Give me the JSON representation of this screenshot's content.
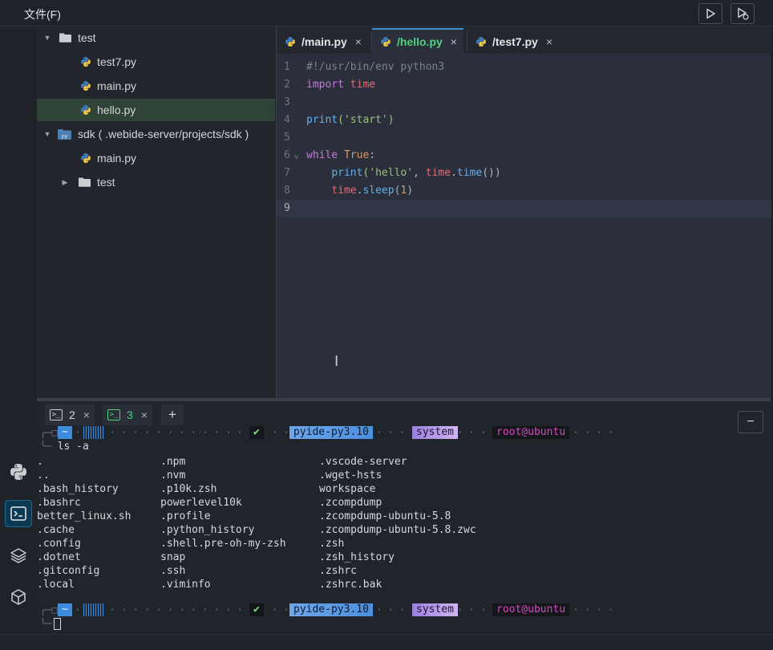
{
  "menu": {
    "file": "文件(F)"
  },
  "toolbar": {
    "run_icon": "play-icon",
    "debug_icon": "debug-run-icon"
  },
  "activity_bar": {
    "items": [
      "python-icon",
      "terminal-icon",
      "layers-icon",
      "package-icon"
    ]
  },
  "explorer": {
    "items": [
      {
        "label": "test"
      },
      {
        "label": "test7.py"
      },
      {
        "label": "main.py"
      },
      {
        "label": "hello.py"
      },
      {
        "label": "sdk ( .webide-server/projects/sdk )"
      },
      {
        "label": "main.py"
      },
      {
        "label": "test"
      }
    ]
  },
  "editor": {
    "tabs": [
      {
        "label": "/main.py",
        "close": "×"
      },
      {
        "label": "/hello.py",
        "close": "×"
      },
      {
        "label": "/test7.py",
        "close": "×"
      }
    ],
    "line_numbers": [
      "1",
      "2",
      "3",
      "4",
      "5",
      "6",
      "7",
      "8",
      "9"
    ],
    "code": {
      "l1": "#!/usr/bin/env python3",
      "l2_kw": "import",
      "l2_mod": "time",
      "l4_fn": "print",
      "l4_str": "('start')",
      "l6_kw": "while",
      "l6_const": "True",
      "l6_colon": ":",
      "l7_fn": "print",
      "l7_str": "('hello'",
      "l7_sep": ", ",
      "l7_mod": "time",
      "l7_dot": ".",
      "l7_fn2": "time",
      "l7_end": "())",
      "l8_mod": "time",
      "l8_dot": ".",
      "l8_fn": "sleep",
      "l8_open": "(",
      "l8_num": "1",
      "l8_close": ")"
    }
  },
  "terminal": {
    "tabs": [
      {
        "label": "2",
        "icon": ">_",
        "close": "×"
      },
      {
        "label": "3",
        "icon": ">_",
        "close": "×"
      }
    ],
    "add": "+",
    "minimize": "−",
    "prompt": {
      "dir": "~",
      "status": "✔",
      "env": "pyide-py3.10",
      "context": "system",
      "user": "root@ubuntu"
    },
    "command": "ls -a",
    "ls_rows": [
      [
        ".",
        ".npm",
        ".vscode-server"
      ],
      [
        "..",
        ".nvm",
        ".wget-hsts"
      ],
      [
        ".bash_history",
        ".p10k.zsh",
        "workspace"
      ],
      [
        ".bashrc",
        "powerlevel10k",
        ".zcompdump"
      ],
      [
        "better_linux.sh",
        ".profile",
        ".zcompdump-ubuntu-5.8"
      ],
      [
        ".cache",
        ".python_history",
        ".zcompdump-ubuntu-5.8.zwc"
      ],
      [
        ".config",
        ".shell.pre-oh-my-zsh",
        ".zsh"
      ],
      [
        ".dotnet",
        "snap",
        ".zsh_history"
      ],
      [
        ".gitconfig",
        ".ssh",
        ".zshrc"
      ],
      [
        ".local",
        ".viminfo",
        ".zshrc.bak"
      ]
    ]
  }
}
